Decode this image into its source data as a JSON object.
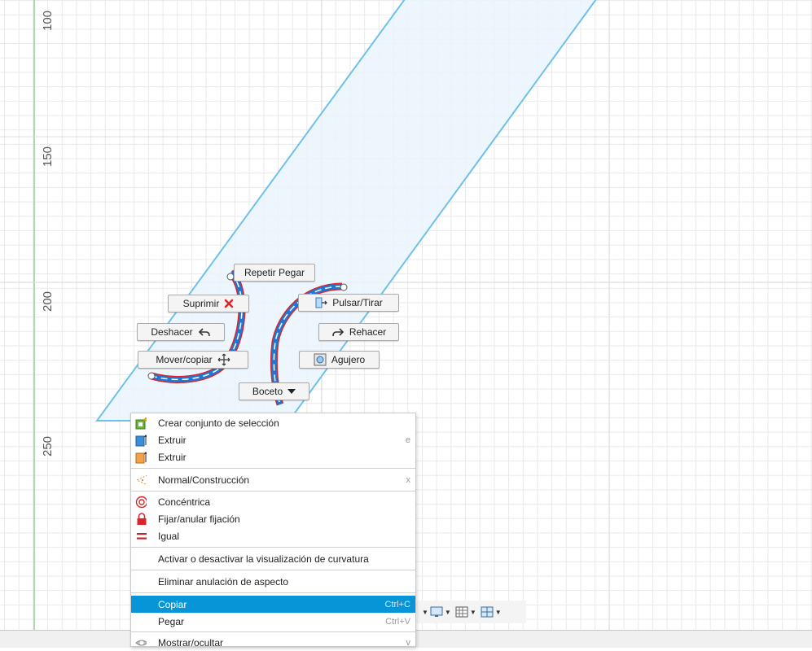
{
  "ruler": {
    "labels": [
      "100",
      "150",
      "200",
      "250"
    ]
  },
  "marking_menu": {
    "repeat_paste": "Repetir Pegar",
    "delete": "Suprimir",
    "undo": "Deshacer",
    "move_copy": "Mover/copiar",
    "press_pull": "Pulsar/Tirar",
    "redo": "Rehacer",
    "hole": "Agujero",
    "sketch": "Boceto"
  },
  "context_menu": {
    "items": [
      {
        "label": "Crear conjunto de selección",
        "shortcut": "",
        "icon": "selection-set-icon"
      },
      {
        "label": "Extruir",
        "shortcut": "e",
        "icon": "extrude-blue-icon"
      },
      {
        "label": "Extruir",
        "shortcut": "",
        "icon": "extrude-orange-icon"
      },
      {
        "label": "Normal/Construcción",
        "shortcut": "x",
        "icon": "construction-icon"
      },
      {
        "label": "Concéntrica",
        "shortcut": "",
        "icon": "concentric-icon"
      },
      {
        "label": "Fijar/anular fijación",
        "shortcut": "",
        "icon": "lock-icon"
      },
      {
        "label": "Igual",
        "shortcut": "",
        "icon": "equal-icon"
      },
      {
        "label": "Activar o desactivar la visualización de curvatura",
        "shortcut": ""
      },
      {
        "label": "Eliminar anulación de aspecto",
        "shortcut": ""
      },
      {
        "label": "Copiar",
        "shortcut": "Ctrl+C"
      },
      {
        "label": "Pegar",
        "shortcut": "Ctrl+V"
      },
      {
        "label": "Mostrar/ocultar",
        "shortcut": "v",
        "icon": "eye-icon"
      }
    ],
    "highlighted": "Copiar"
  },
  "colors": {
    "accent": "#0696d7",
    "sketch_line": "#6ec1e8",
    "profile_fill": "#eaf5fc",
    "selected_curve": "#1c78d8",
    "constraint_red": "#d9262b",
    "axis_green": "#8fd38f"
  }
}
